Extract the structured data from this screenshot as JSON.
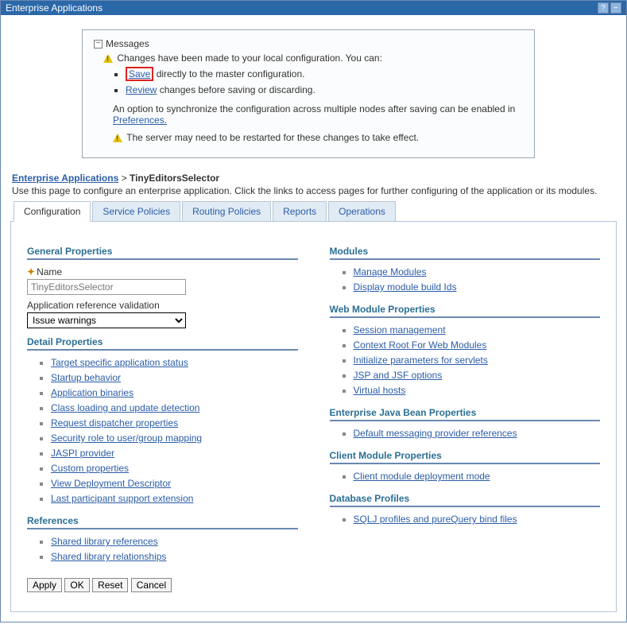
{
  "title": "Enterprise Applications",
  "messages": {
    "heading": "Messages",
    "line1": "Changes have been made to your local configuration. You can:",
    "save_link": "Save",
    "save_tail": " directly to the master configuration.",
    "review_link": "Review",
    "review_tail": " changes before saving or discarding.",
    "sync_pre": "An option to synchronize the configuration across multiple nodes after saving can be enabled in ",
    "sync_link": "Preferences.",
    "restart": "The server may need to be restarted for these changes to take effect."
  },
  "breadcrumb": {
    "root": "Enterprise Applications",
    "sep": ">",
    "current": "TinyEditorsSelector"
  },
  "page_desc": "Use this page to configure an enterprise application. Click the links to access pages for further configuring of the application or its modules.",
  "tabs": [
    "Configuration",
    "Service Policies",
    "Routing Policies",
    "Reports",
    "Operations"
  ],
  "sections": {
    "general": {
      "head": "General Properties",
      "name_label": "Name",
      "name_value": "TinyEditorsSelector",
      "refval_label": "Application reference validation",
      "refval_value": "Issue warnings"
    },
    "detail": {
      "head": "Detail Properties",
      "items": [
        "Target specific application status",
        "Startup behavior",
        "Application binaries",
        "Class loading and update detection",
        "Request dispatcher properties",
        "Security role to user/group mapping",
        "JASPI provider",
        "Custom properties",
        "View Deployment Descriptor",
        "Last participant support extension"
      ]
    },
    "references": {
      "head": "References",
      "items": [
        "Shared library references",
        "Shared library relationships"
      ]
    },
    "modules": {
      "head": "Modules",
      "items": [
        "Manage Modules",
        "Display module build Ids"
      ]
    },
    "web": {
      "head": "Web Module Properties",
      "items": [
        "Session management",
        "Context Root For Web Modules",
        "Initialize parameters for servlets",
        "JSP and JSF options",
        "Virtual hosts"
      ]
    },
    "ejb": {
      "head": "Enterprise Java Bean Properties",
      "items": [
        "Default messaging provider references"
      ]
    },
    "client": {
      "head": "Client Module Properties",
      "items": [
        "Client module deployment mode"
      ]
    },
    "db": {
      "head": "Database Profiles",
      "items": [
        "SQLJ profiles and pureQuery bind files"
      ]
    }
  },
  "buttons": {
    "apply": "Apply",
    "ok": "OK",
    "reset": "Reset",
    "cancel": "Cancel"
  }
}
